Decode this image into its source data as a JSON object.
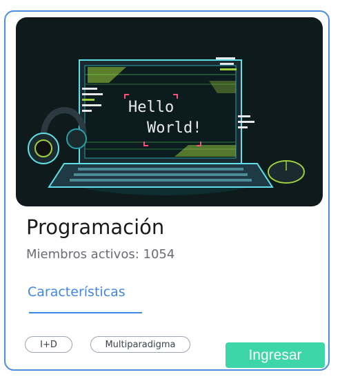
{
  "card": {
    "title": "Programación",
    "members": "Miembros activos: 1054",
    "features_label": "Características",
    "tags": [
      "I+D",
      "Multiparadigma"
    ],
    "cta_label": "Ingresar"
  },
  "banner": {
    "screen_text_line1": "Hello",
    "screen_text_line2": "World!",
    "icon": "laptop-headphones-mouse-illustration"
  },
  "colors": {
    "border": "#4a8ee0",
    "accent_blue": "#3f87e6",
    "cta": "#3dd6a8",
    "banner_bg": "#0f1a1c"
  }
}
